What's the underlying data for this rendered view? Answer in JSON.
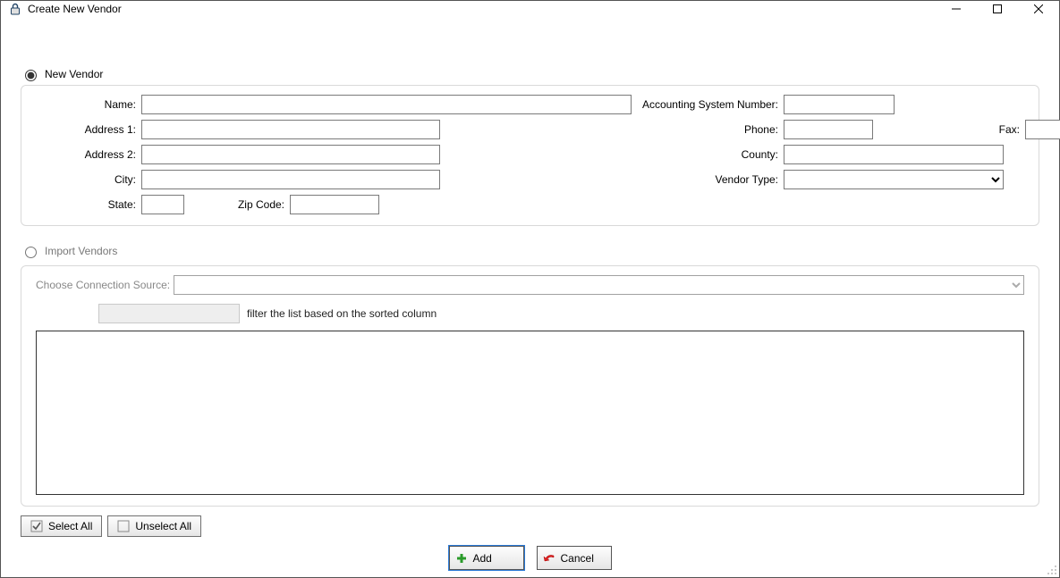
{
  "window": {
    "title": "Create New Vendor"
  },
  "radios": {
    "newVendor": "New Vendor",
    "importVendors": "Import Vendors",
    "selected": "new"
  },
  "labels": {
    "name": "Name:",
    "address1": "Address 1:",
    "address2": "Address 2:",
    "city": "City:",
    "state": "State:",
    "zip": "Zip Code:",
    "asn": "Accounting System Number:",
    "phone": "Phone:",
    "fax": "Fax:",
    "county": "County:",
    "vendorType": "Vendor Type:",
    "connSource": "Choose Connection Source:",
    "filterHint": "filter the list based on the sorted column"
  },
  "values": {
    "name": "",
    "address1": "",
    "address2": "",
    "city": "",
    "state": "",
    "zip": "",
    "asn": "",
    "phone": "",
    "fax": "",
    "county": "",
    "vendorType": "",
    "connSource": "",
    "filter": ""
  },
  "buttons": {
    "selectAll": "Select All",
    "unselectAll": "Unselect All",
    "add": "Add",
    "cancel": "Cancel"
  }
}
